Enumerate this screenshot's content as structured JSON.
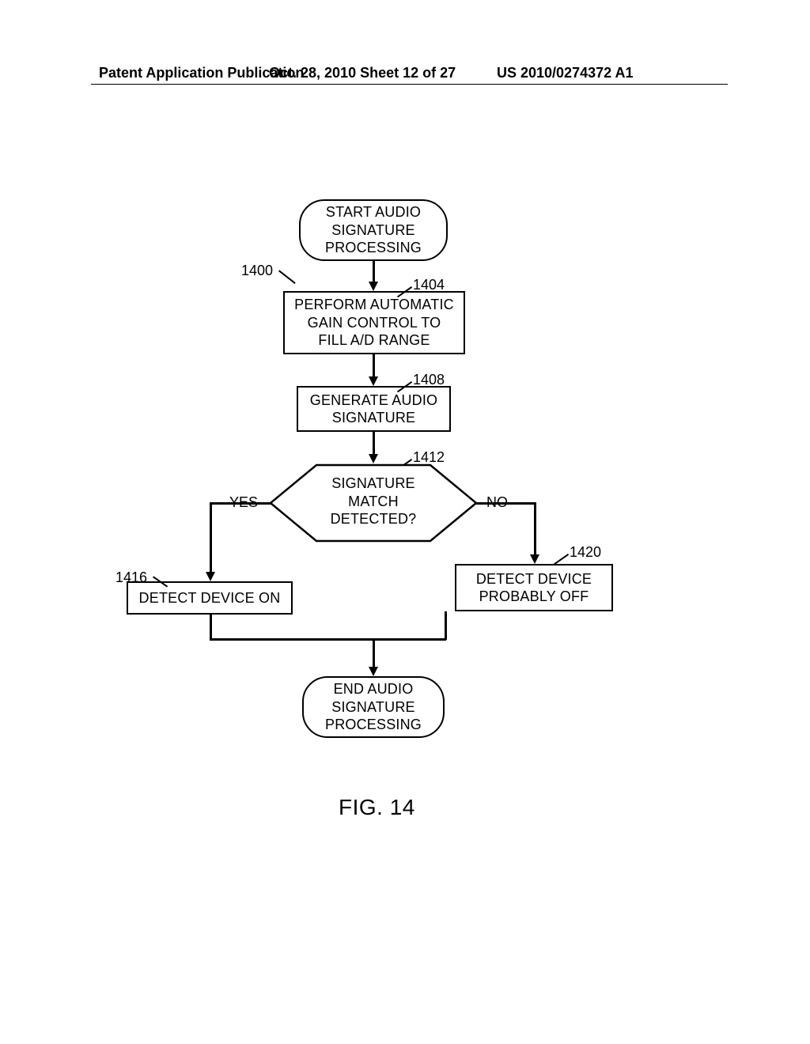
{
  "header": {
    "left": "Patent Application Publication",
    "mid": "Oct. 28, 2010  Sheet 12 of 27",
    "right": "US 2010/0274372 A1"
  },
  "figure_caption": "FIG. 14",
  "refs": {
    "main": "1400",
    "agc": "1404",
    "gen": "1408",
    "decision": "1412",
    "on": "1416",
    "off": "1420"
  },
  "nodes": {
    "start": "START AUDIO\nSIGNATURE\nPROCESSING",
    "agc": "PERFORM AUTOMATIC\nGAIN CONTROL TO\nFILL A/D RANGE",
    "gen": "GENERATE AUDIO\nSIGNATURE",
    "decision": "SIGNATURE\nMATCH\nDETECTED?",
    "yes": "YES",
    "no": "NO",
    "on": "DETECT DEVICE ON",
    "off": "DETECT DEVICE\nPROBABLY OFF",
    "end": "END AUDIO\nSIGNATURE\nPROCESSING"
  },
  "chart_data": {
    "type": "other",
    "subtype": "flowchart",
    "title": "FIG. 14",
    "nodes": [
      {
        "id": "start",
        "kind": "terminator",
        "text": "START AUDIO SIGNATURE PROCESSING"
      },
      {
        "id": "agc",
        "kind": "process",
        "ref": "1404",
        "text": "PERFORM AUTOMATIC GAIN CONTROL TO FILL A/D RANGE"
      },
      {
        "id": "gen",
        "kind": "process",
        "ref": "1408",
        "text": "GENERATE AUDIO SIGNATURE"
      },
      {
        "id": "decision",
        "kind": "decision",
        "ref": "1412",
        "text": "SIGNATURE MATCH DETECTED?"
      },
      {
        "id": "on",
        "kind": "process",
        "ref": "1416",
        "text": "DETECT DEVICE ON"
      },
      {
        "id": "off",
        "kind": "process",
        "ref": "1420",
        "text": "DETECT DEVICE PROBABLY OFF"
      },
      {
        "id": "end",
        "kind": "terminator",
        "text": "END AUDIO SIGNATURE PROCESSING"
      }
    ],
    "edges": [
      {
        "from": "start",
        "to": "agc"
      },
      {
        "from": "agc",
        "to": "gen"
      },
      {
        "from": "gen",
        "to": "decision"
      },
      {
        "from": "decision",
        "to": "on",
        "label": "YES"
      },
      {
        "from": "decision",
        "to": "off",
        "label": "NO"
      },
      {
        "from": "on",
        "to": "end"
      },
      {
        "from": "off",
        "to": "end"
      }
    ],
    "figure_ref": "1400"
  }
}
